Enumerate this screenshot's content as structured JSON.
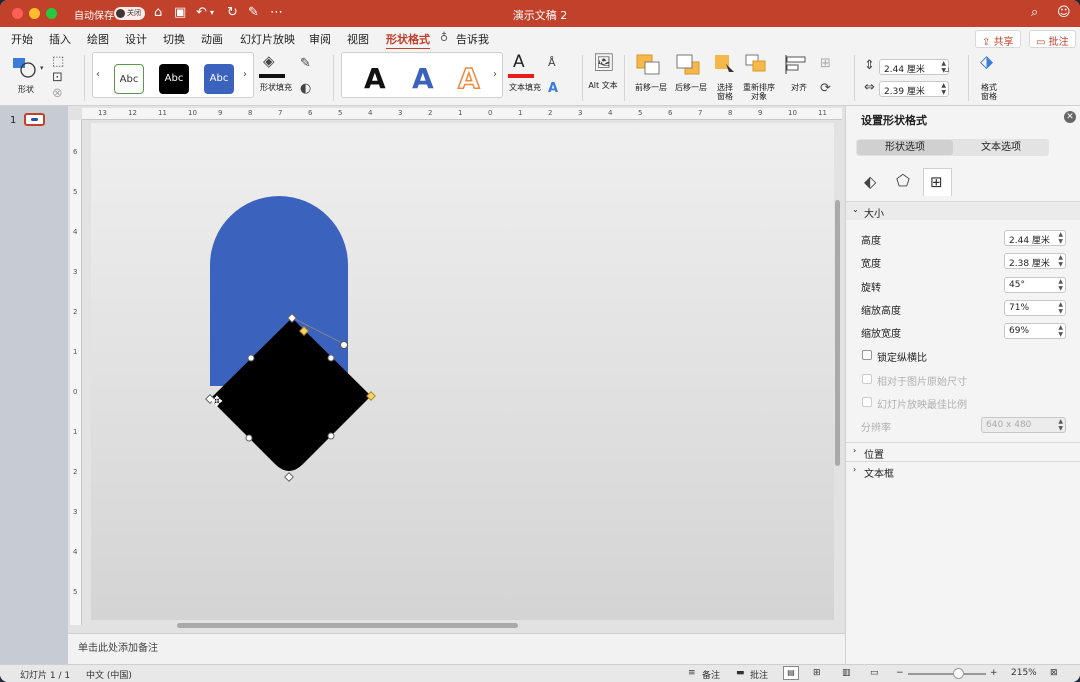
{
  "colors": {
    "accent": "#c2412b",
    "shape_blue": "#3b63bd",
    "shape_black": "#000000"
  },
  "titlebar": {
    "autosave_label": "自动保存",
    "autosave_state": "关闭",
    "doc_title": "演示文稿 2"
  },
  "menu_tabs": [
    "开始",
    "插入",
    "绘图",
    "设计",
    "切换",
    "动画",
    "幻灯片放映",
    "审阅",
    "视图",
    "形状格式"
  ],
  "tell_me": "告诉我",
  "share_label": "共享",
  "comment_label": "批注",
  "ribbon": {
    "shapes_label": "形状",
    "style_sample": "Abc",
    "shape_fill_label": "形状填充",
    "wordart_letter": "A",
    "text_fill_label": "文本填充",
    "alt_text_label": "Alt 文本",
    "bring_forward_label": "前移一层",
    "send_backward_label": "后移一层",
    "selection_pane_label": "选择窗格",
    "reorder_label": "重新排序对象",
    "align_label": "对齐",
    "height_value": "2.44 厘米",
    "width_value": "2.39 厘米",
    "format_pane_label": "格式窗格"
  },
  "thumbnail": {
    "number": "1"
  },
  "rulers": {
    "h": [
      "13",
      "12",
      "11",
      "10",
      "9",
      "8",
      "7",
      "6",
      "5",
      "4",
      "3",
      "2",
      "1",
      "0",
      "1",
      "2",
      "3",
      "4",
      "5",
      "6",
      "7",
      "8",
      "9",
      "10",
      "11",
      "12",
      "13"
    ],
    "v": [
      "6",
      "5",
      "4",
      "3",
      "2",
      "1",
      "0",
      "1",
      "2",
      "3",
      "4",
      "5"
    ]
  },
  "notes_placeholder": "单击此处添加备注",
  "format_pane": {
    "title": "设置形状格式",
    "tab_shape": "形状选项",
    "tab_text": "文本选项",
    "size_section": "大小",
    "fields": [
      {
        "label": "高度",
        "value": "2.44 厘米"
      },
      {
        "label": "宽度",
        "value": "2.38 厘米"
      },
      {
        "label": "旋转",
        "value": "45°"
      },
      {
        "label": "缩放高度",
        "value": "71%"
      },
      {
        "label": "缩放宽度",
        "value": "69%"
      }
    ],
    "lock_aspect": "锁定纵横比",
    "relative_original": "相对于图片原始尺寸",
    "best_scale": "幻灯片放映最佳比例",
    "resolution_label": "分辨率",
    "resolution_value": "640 x 480",
    "position_section": "位置",
    "textbox_section": "文本框"
  },
  "status": {
    "slide_info": "幻灯片 1 / 1",
    "language": "中文 (中国)",
    "notes_label": "备注",
    "comments_label": "批注",
    "zoom": "215%"
  }
}
